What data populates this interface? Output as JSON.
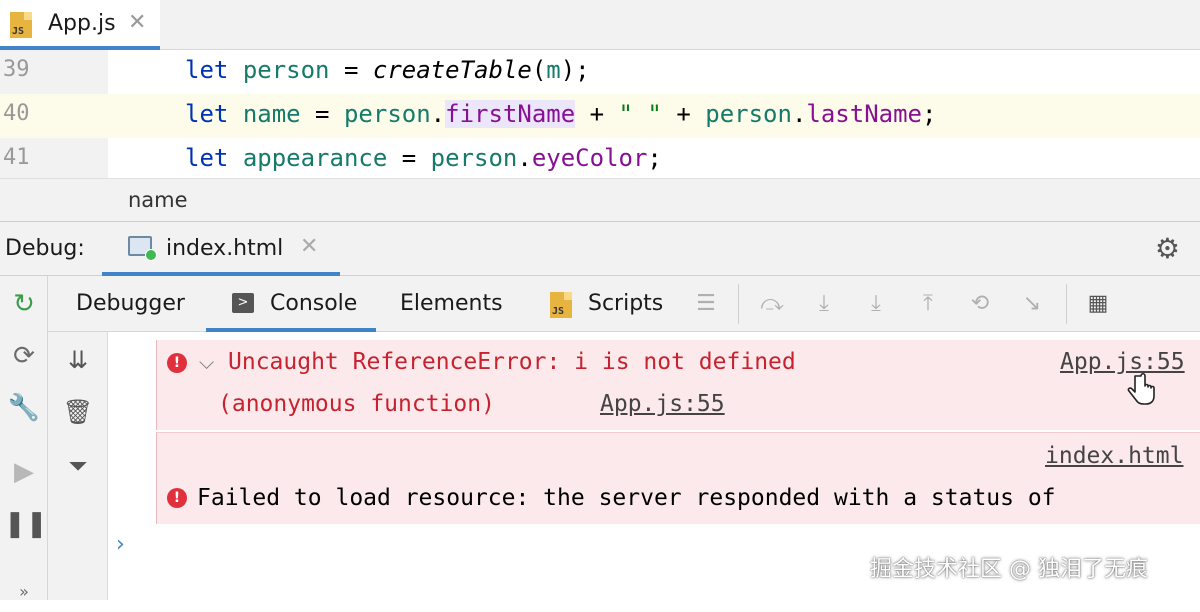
{
  "editor": {
    "tab": {
      "name": "App.js",
      "icon": "js-file-icon",
      "icon_label": "JS"
    },
    "lines": [
      {
        "number": "39",
        "code": "let person = createTable(m);"
      },
      {
        "number": "40",
        "code": "let name = person.firstName + \" \" + person.lastName;"
      },
      {
        "number": "41",
        "code": "let appearance = person.eyeColor;"
      }
    ],
    "tokens": {
      "let": "let",
      "person": "person",
      "eq": " = ",
      "createTable": "createTable",
      "m": "m",
      "open_paren": "(",
      "close_semi": ");",
      "name": "name",
      "dot": ".",
      "firstName": "firstName",
      "plus": " + ",
      "space_str": "\" \"",
      "lastName": "lastName",
      "semi": ";",
      "appearance": "appearance",
      "eyeColor": "eyeColor"
    },
    "breadcrumb": "name"
  },
  "debug": {
    "title": "Debug:",
    "tab": "index.html",
    "tabs": [
      {
        "label": "Debugger"
      },
      {
        "label": "Console",
        "active": true,
        "icon_glyph": ">"
      },
      {
        "label": "Elements"
      },
      {
        "label": "Scripts",
        "icon_label": "JS"
      }
    ]
  },
  "console": {
    "messages": [
      {
        "text": "Uncaught ReferenceError: i is not defined",
        "source": "App.js:55",
        "stack_fn": "(anonymous function)",
        "stack_source": "App.js:55",
        "icon": "error-icon"
      },
      {
        "source": "index.html",
        "text": "Failed to load resource: the server responded with a status of",
        "icon": "error-icon"
      }
    ],
    "prompt": "›"
  },
  "watermark": "掘金技术社区 @ 独泪了无痕",
  "colors": {
    "accent": "#4083c9",
    "error": "#c7222f",
    "error_bg": "#fbe9eb",
    "keyword": "#0033b3",
    "variable": "#167a6a",
    "property": "#871094",
    "string": "#067d17"
  }
}
